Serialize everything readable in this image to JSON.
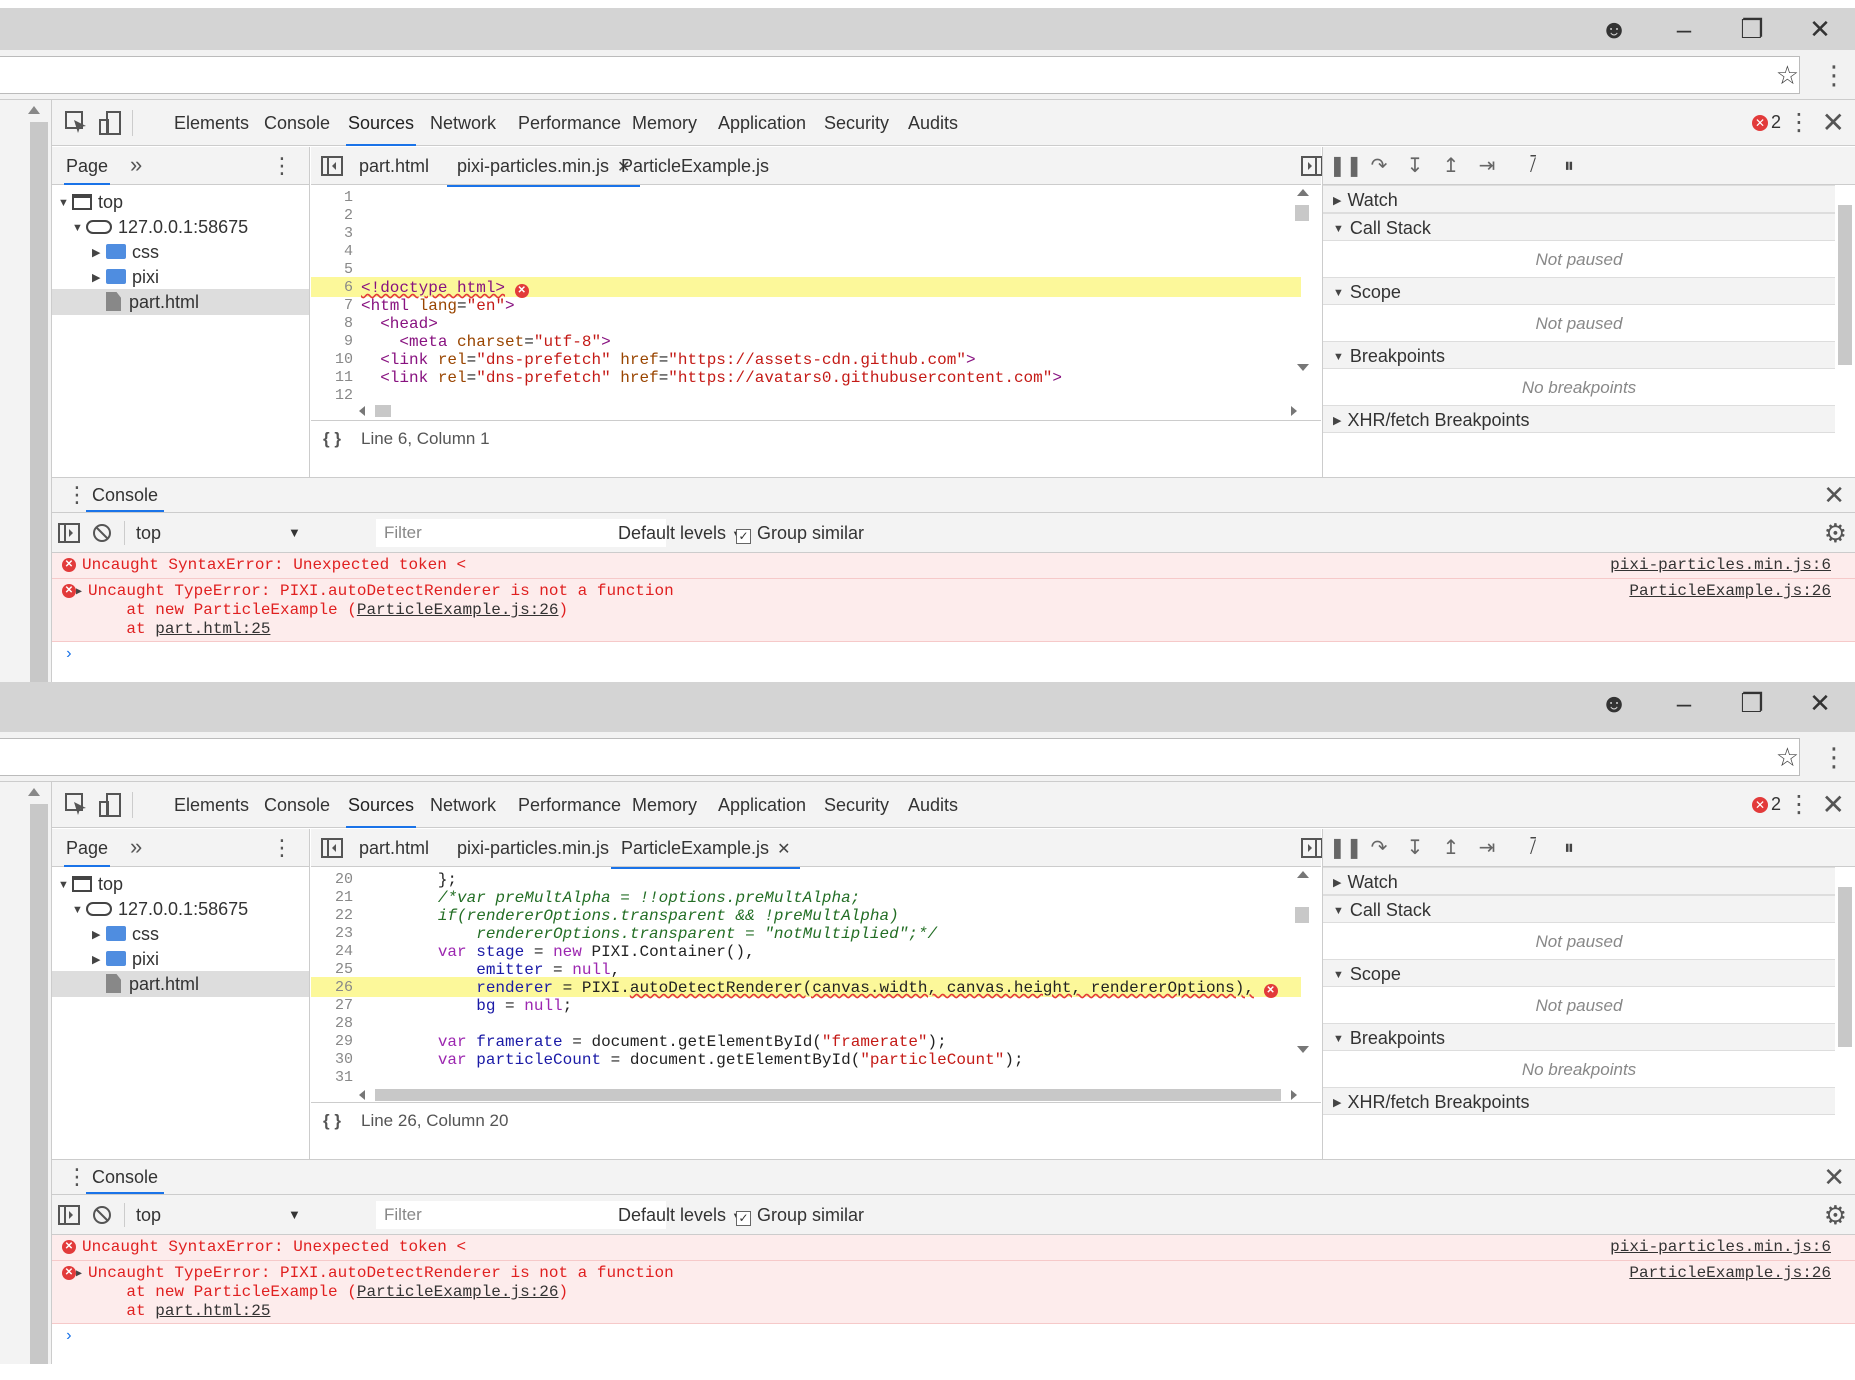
{
  "devtools_tabs": [
    "Elements",
    "Console",
    "Sources",
    "Network",
    "Performance",
    "Memory",
    "Application",
    "Security",
    "Audits"
  ],
  "error_count": "2",
  "nav": {
    "page_label": "Page",
    "more": "»",
    "tree": [
      "top",
      "127.0.0.1:58675",
      "css",
      "pixi",
      "part.html"
    ]
  },
  "debugger": {
    "watch": "Watch",
    "call_stack": "Call Stack",
    "not_paused": "Not paused",
    "scope": "Scope",
    "breakpoints": "Breakpoints",
    "no_breakpoints": "No breakpoints",
    "xhr": "XHR/fetch Breakpoints"
  },
  "console": {
    "drawer_label": "Console",
    "context": "top",
    "filter_placeholder": "Filter",
    "levels": "Default levels",
    "group_similar": "Group similar",
    "msg1": "Uncaught SyntaxError: Unexpected token <",
    "msg1_src": "pixi-particles.min.js:6",
    "msg2": "Uncaught TypeError: PIXI.autoDetectRenderer is not a function",
    "msg2_src": "ParticleExample.js:26",
    "msg2_at1_prefix": "    at new ParticleExample (",
    "msg2_at1_link": "ParticleExample.js:26",
    "msg2_at1_suffix": ")",
    "msg2_at2_prefix": "    at ",
    "msg2_at2_link": "part.html:25"
  },
  "window1": {
    "editor_tabs": [
      "part.html",
      "pixi-particles.min.js",
      "ParticleExample.js"
    ],
    "active_tab": 1,
    "status": "Line 6, Column 1",
    "line_numbers": [
      "1",
      "2",
      "3",
      "4",
      "5",
      "6",
      "7",
      "8",
      "9",
      "10",
      "11",
      "12"
    ]
  },
  "window2": {
    "editor_tabs": [
      "part.html",
      "pixi-particles.min.js",
      "ParticleExample.js"
    ],
    "active_tab": 2,
    "status": "Line 26, Column 20",
    "line_numbers": [
      "20",
      "21",
      "22",
      "23",
      "24",
      "25",
      "26",
      "27",
      "28",
      "29",
      "30",
      "31"
    ]
  }
}
